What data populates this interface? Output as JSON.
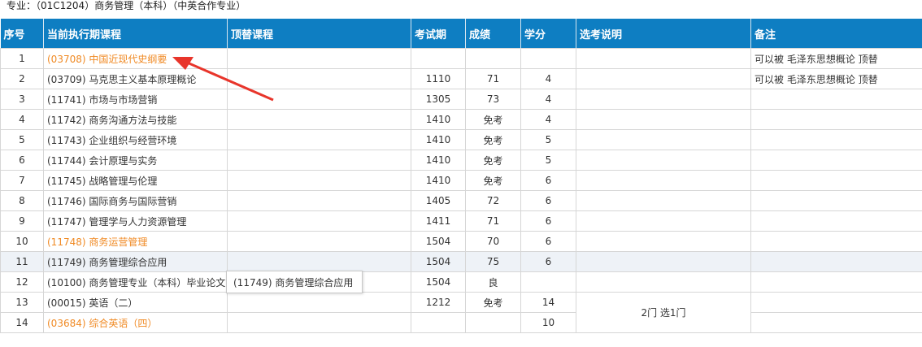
{
  "major_line": "专业：（01C1204）商务管理（本科）（中英合作专业）",
  "headers": [
    "序号",
    "当前执行期课程",
    "顶替课程",
    "考试期",
    "成绩",
    "学分",
    "选考说明",
    "备注"
  ],
  "rows": [
    {
      "no": "1",
      "course": "(03708)  中国近现代史纲要",
      "replace": "",
      "period": "",
      "score": "",
      "credit": "",
      "note": "可以被 毛泽东思想概论 顶替",
      "orange": true
    },
    {
      "no": "2",
      "course": "(03709)  马克思主义基本原理概论",
      "replace": "",
      "period": "1110",
      "score": "71",
      "credit": "4",
      "note": "可以被 毛泽东思想概论 顶替"
    },
    {
      "no": "3",
      "course": "(11741)  市场与市场营销",
      "replace": "",
      "period": "1305",
      "score": "73",
      "credit": "4",
      "note": ""
    },
    {
      "no": "4",
      "course": "(11742)  商务沟通方法与技能",
      "replace": "",
      "period": "1410",
      "score": "免考",
      "credit": "4",
      "note": ""
    },
    {
      "no": "5",
      "course": "(11743)  企业组织与经营环境",
      "replace": "",
      "period": "1410",
      "score": "免考",
      "credit": "5",
      "note": ""
    },
    {
      "no": "6",
      "course": "(11744)  会计原理与实务",
      "replace": "",
      "period": "1410",
      "score": "免考",
      "credit": "5",
      "note": ""
    },
    {
      "no": "7",
      "course": "(11745)  战略管理与伦理",
      "replace": "",
      "period": "1410",
      "score": "免考",
      "credit": "6",
      "note": ""
    },
    {
      "no": "8",
      "course": "(11746)  国际商务与国际营销",
      "replace": "",
      "period": "1405",
      "score": "72",
      "credit": "6",
      "note": ""
    },
    {
      "no": "9",
      "course": "(11747)  管理学与人力资源管理",
      "replace": "",
      "period": "1411",
      "score": "71",
      "credit": "6",
      "note": ""
    },
    {
      "no": "10",
      "course": "(11748)  商务运营管理",
      "replace": "",
      "period": "1504",
      "score": "70",
      "credit": "6",
      "note": "",
      "orange": true
    },
    {
      "no": "11",
      "course": "(11749)  商务管理综合应用",
      "replace": "",
      "period": "1504",
      "score": "75",
      "credit": "6",
      "note": "",
      "highlight": true
    },
    {
      "no": "12",
      "course": "(10100)  商务管理专业（本科）毕业论文",
      "replace": "",
      "period": "1504",
      "score": "良",
      "credit": "",
      "note": ""
    },
    {
      "no": "13",
      "course": "(00015)  英语（二）",
      "replace": "",
      "period": "1212",
      "score": "免考",
      "credit": "14",
      "note": ""
    },
    {
      "no": "14",
      "course": "(03684)  综合英语（四）",
      "replace": "",
      "period": "",
      "score": "",
      "credit": "10",
      "note": "",
      "orange": true
    }
  ],
  "elective_note": "2门 选1门",
  "tooltip": "(11749) 商务管理综合应用",
  "colors": {
    "header_bg": "#0e7ec2",
    "orange_text": "#f08a24",
    "arrow": "#e8352b",
    "highlight_row": "#eef2f7"
  }
}
